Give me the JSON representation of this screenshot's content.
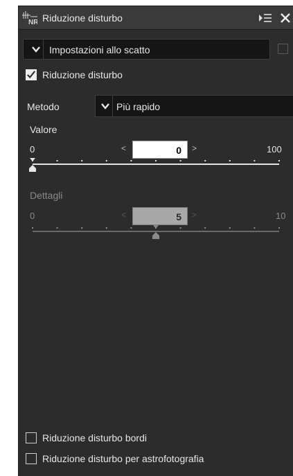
{
  "panel": {
    "title": "Riduzione disturbo",
    "icons": {
      "panel_icon": "noise-reduction-icon",
      "menu": "panel-menu-icon",
      "close": "close-icon"
    }
  },
  "preset": {
    "value": "Impostazioni allo scatto"
  },
  "noise_reduction": {
    "label": "Riduzione disturbo",
    "checked": true
  },
  "method": {
    "label": "Metodo",
    "value": "Più rapido"
  },
  "value_slider": {
    "label": "Valore",
    "min": "0",
    "max": "100",
    "value": "0",
    "level": 0.0
  },
  "detail_slider": {
    "label": "Dettagli",
    "min": "0",
    "max": "10",
    "value": "5",
    "level": 0.5,
    "disabled": true
  },
  "edge_nr": {
    "label": "Riduzione disturbo bordi",
    "checked": false
  },
  "astro_nr": {
    "label": "Riduzione disturbo per astrofotografia",
    "checked": false
  },
  "colors": {
    "panel": "#2c2c2c",
    "field": "#151515",
    "disabled": "#8a8a8a"
  }
}
